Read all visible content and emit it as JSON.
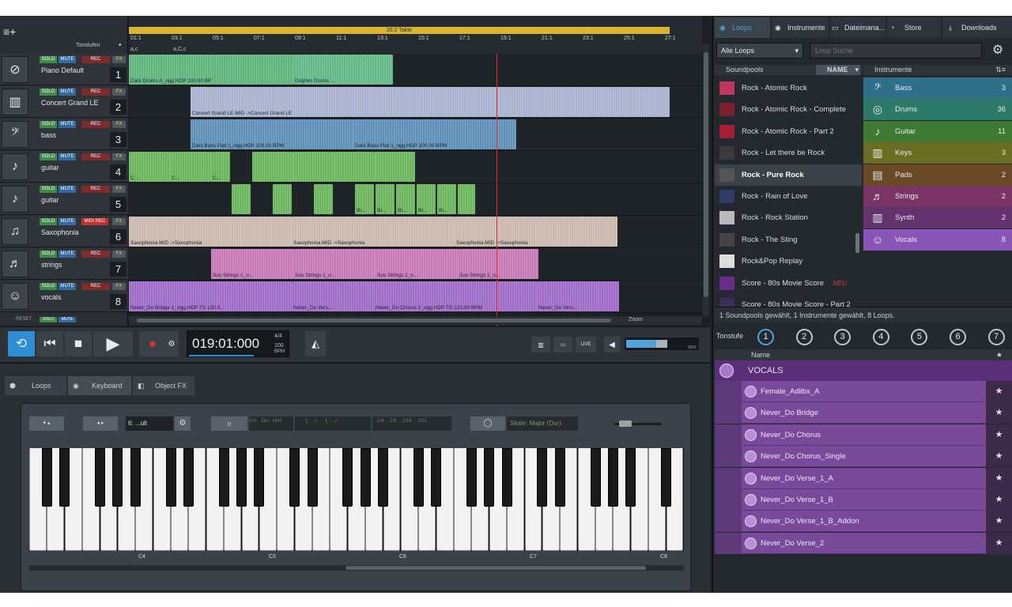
{
  "arranger": {
    "tonestufen_label": "Tonstufen",
    "takt_label": "26:2 Takte",
    "ticks": [
      "01:1",
      "03:1",
      "05:1",
      "07:1",
      "09:1",
      "11:1",
      "13:1",
      "15:1",
      "17:1",
      "19:1",
      "21:1",
      "23:1",
      "25:1",
      "27:1"
    ],
    "key_row_a": "a,c",
    "key_row_b": "a,C,c",
    "reset": "RESET",
    "zoom": "Zoom"
  },
  "tracks": [
    {
      "name": "Piano Default",
      "num": "1",
      "icon": "⊘",
      "rec": "REC"
    },
    {
      "name": "Concert Grand LE",
      "num": "2",
      "icon": "▥",
      "rec": "REC"
    },
    {
      "name": "bass",
      "num": "3",
      "icon": "𝄢",
      "rec": "REC"
    },
    {
      "name": "guitar",
      "num": "4",
      "icon": "♪",
      "rec": "REC"
    },
    {
      "name": "guitar",
      "num": "5",
      "icon": "♪",
      "rec": "REC"
    },
    {
      "name": "Saxophonia",
      "num": "6",
      "icon": "♫",
      "rec": "MIDI REC"
    },
    {
      "name": "strings",
      "num": "7",
      "icon": "♬",
      "rec": "REC"
    },
    {
      "name": "vocals",
      "num": "8",
      "icon": "☺",
      "rec": "REC"
    }
  ],
  "track_btn": {
    "solo": "SOLO",
    "mute": "MUTE",
    "fx": "FX"
  },
  "clip_captions": {
    "drums1": "Dark Drums A_ogg.HDP 100.00 BPM",
    "drums2": "Dolphin Drums ...",
    "concert1": "Concert Grand LE.MID ->Concert Grand LE",
    "bass1": "Dark Bass Pad 1_ogg.HDP 100.00 BPM",
    "bass2": "Dark Bass Pad 1_ogg.HDP 100.00 BPM",
    "g1": "C...",
    "br": "Br...",
    "sax": "Saxophonia.MID ->Saxophonia",
    "str": "Sus Strings 1_o...",
    "voc1": "Never_Do Bridge 1_ogg.HDP  TS  120.0...",
    "voc2": "Never_Do Vers...",
    "voc3": "Never_Do Chorus 1_ogg.HDP  TS  120.00 BPM",
    "voc4": "Never_Do Vers..."
  },
  "transport": {
    "time": "019:01:000",
    "sig": "4/4",
    "bpm": "100 BPM",
    "bpm_label": "100",
    "bpm_unit": "BPM",
    "live": "LIVE",
    "midi": "MIDI"
  },
  "lower_tabs": [
    "Loops",
    "Keyboard",
    "Object FX"
  ],
  "keyboard": {
    "preset": "6: ...ult",
    "scale": "Skale: Major (Dur)",
    "labels_mode": [
      "Chr.",
      "Dur",
      "Moll"
    ],
    "divs": [
      "1/4",
      "1/8",
      "1/16",
      "1/32"
    ],
    "octaves": [
      "C4",
      "C5",
      "C6",
      "C7",
      "C8"
    ]
  },
  "browser": {
    "tabs": [
      "Loops",
      "Instrumente",
      "Dateimana...",
      "Store",
      "Downloads"
    ],
    "filter": "Alle Loops",
    "search_placeholder": "Loop Suche",
    "col_soundpools": "Soundpools",
    "col_name": "NAME",
    "col_instrumente": "Instrumente",
    "soundpools": [
      "Rock - Atomic Rock",
      "Rock - Atomic Rock - Complete",
      "Rock - Atomic Rock - Part 2",
      "Rock - Let there be Rock",
      "Rock - Pure Rock",
      "Rock - Rain of Love",
      "Rock - Rock Station",
      "Rock - The Sting",
      "Rock&Pop Replay",
      "Score - 80s Movie Score",
      "Score - 80s Movie Score - Part 2"
    ],
    "new_badge": "NEU",
    "instruments": [
      {
        "name": "Bass",
        "count": "3",
        "color": "#2f6f8a",
        "icon": "𝄢"
      },
      {
        "name": "Drums",
        "count": "36",
        "color": "#2d7a6a",
        "icon": "◎"
      },
      {
        "name": "Guitar",
        "count": "11",
        "color": "#3f7a35",
        "icon": "♪"
      },
      {
        "name": "Keys",
        "count": "3",
        "color": "#6b6e22",
        "icon": "▥"
      },
      {
        "name": "Pads",
        "count": "2",
        "color": "#6a4a24",
        "icon": "▤"
      },
      {
        "name": "Strings",
        "count": "2",
        "color": "#7a3466",
        "icon": "♬"
      },
      {
        "name": "Synth",
        "count": "2",
        "color": "#63336e",
        "icon": "▥"
      },
      {
        "name": "Vocals",
        "count": "8",
        "color": "#8a55b8",
        "icon": "☺"
      }
    ],
    "status": "1 Soundpools gewählt, 1 Instrumente gewählt, 8 Loops.",
    "tonstufe_label": "Tonstufe",
    "tonstufen": [
      "1",
      "2",
      "3",
      "4",
      "5",
      "6",
      "7"
    ],
    "name_col": "Name",
    "vocals_header": "VOCALS",
    "loops": [
      "Female_Adlibs_A",
      "Never_Do Bridge",
      "Never_Do Chorus",
      "Never_Do Chorus_Single",
      "Never_Do Verse_1_A",
      "Never_Do Verse_1_B",
      "Never_Do Verse_1_B_Addon",
      "Never_Do Verse_2"
    ]
  }
}
